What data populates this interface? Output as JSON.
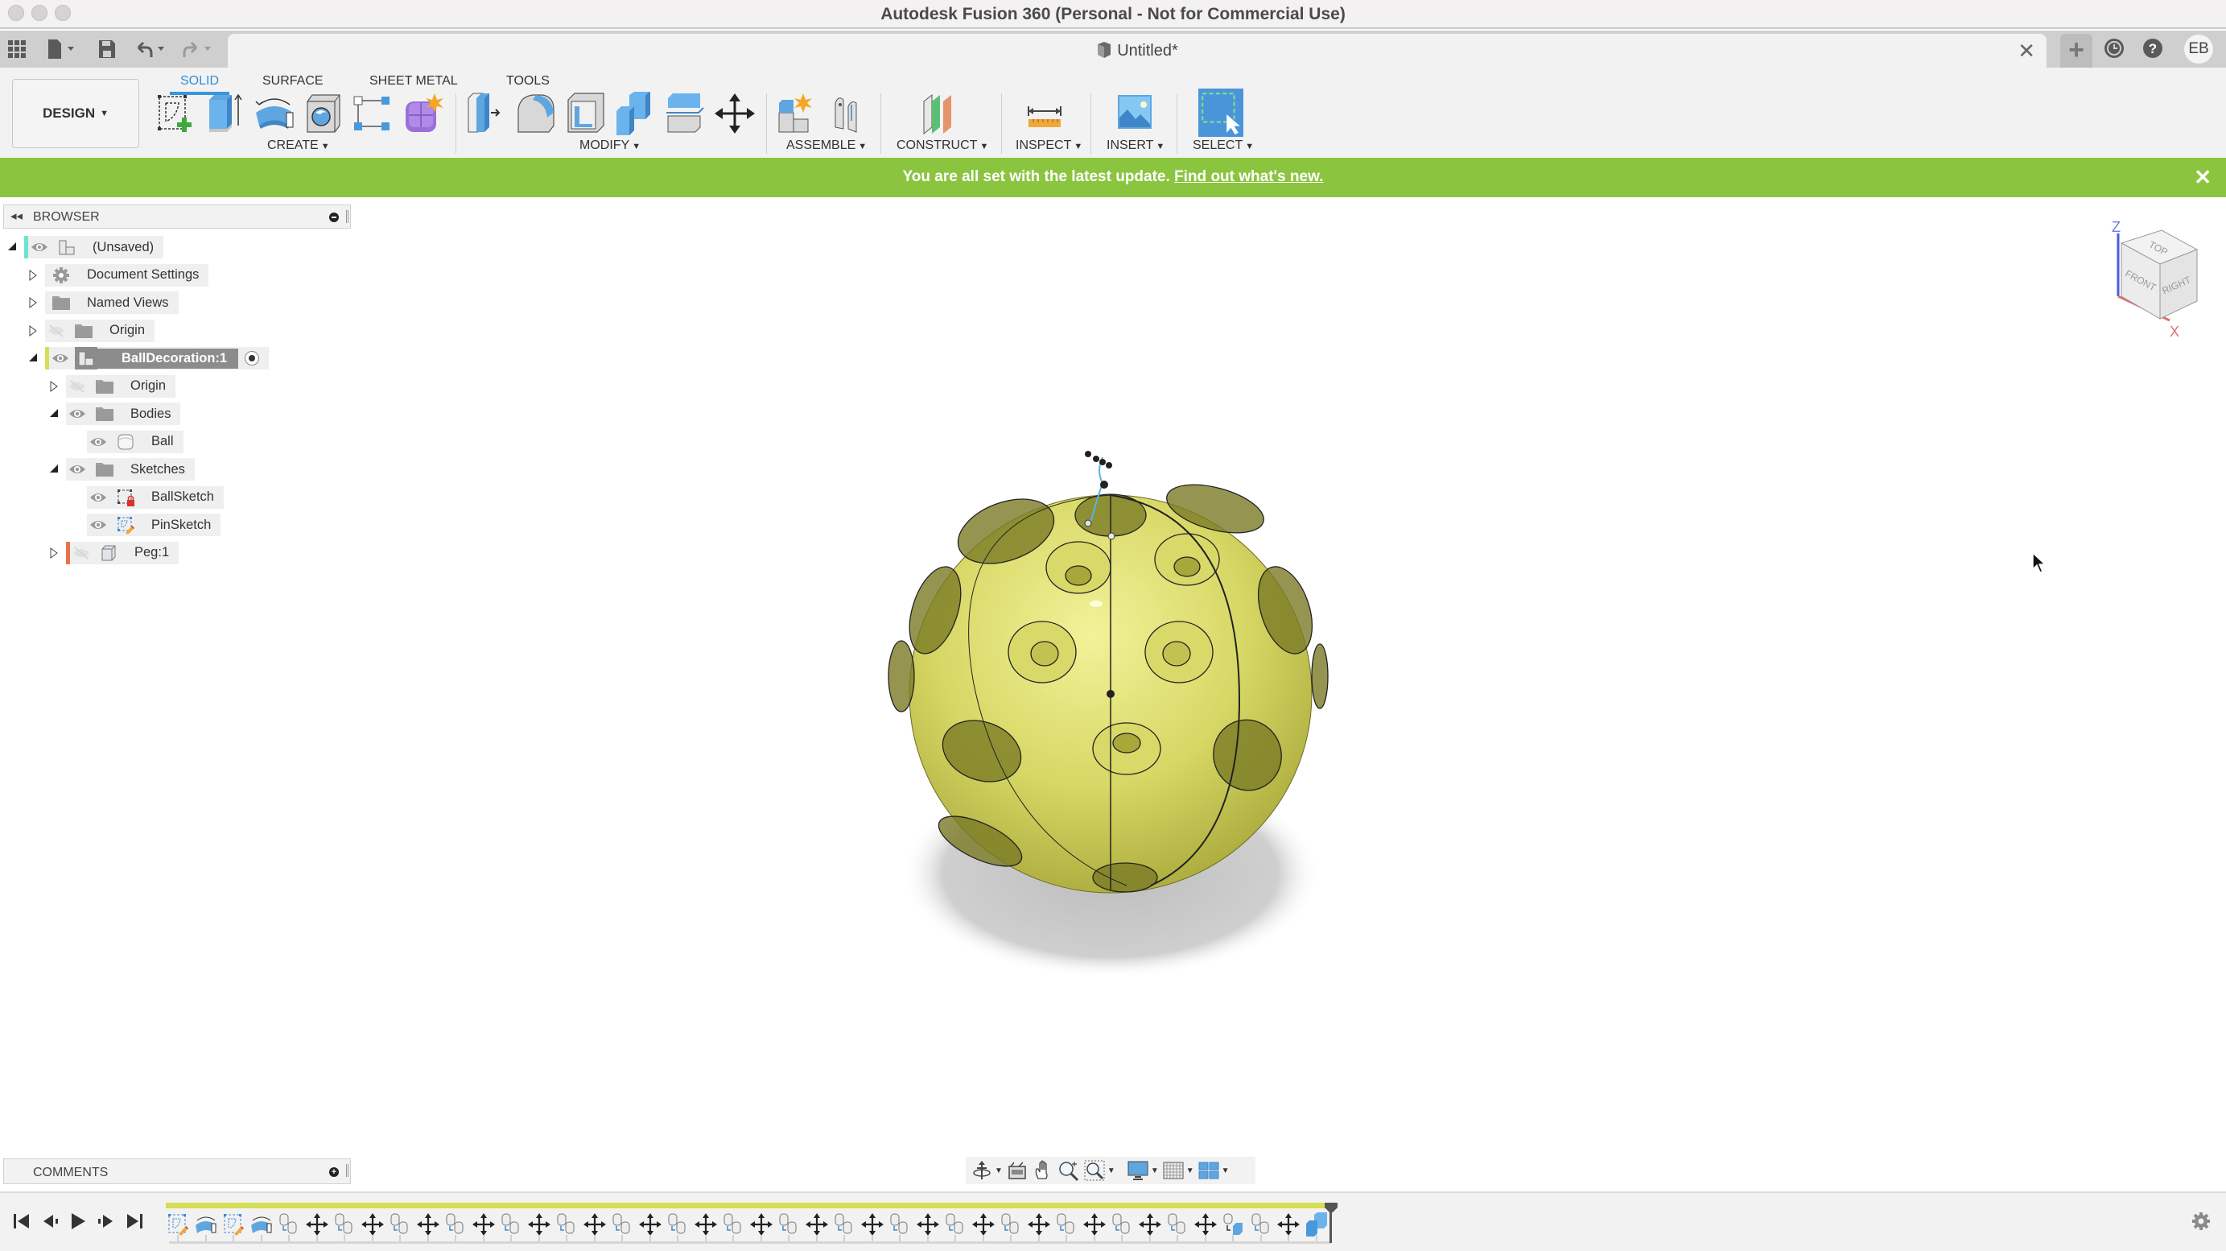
{
  "window": {
    "title": "Autodesk Fusion 360 (Personal - Not for Commercial Use)"
  },
  "tabbar": {
    "document_tab_title": "Untitled*",
    "user_initials": "EB",
    "icons": [
      "apps-grid-icon",
      "file-icon",
      "save-icon",
      "undo-icon",
      "redo-icon",
      "close-icon",
      "new-tab-plus-icon",
      "job-status-clock-icon",
      "help-icon"
    ]
  },
  "toolbar": {
    "workspace_button": "DESIGN",
    "tabs": [
      {
        "label": "SOLID",
        "active": true
      },
      {
        "label": "SURFACE",
        "active": false
      },
      {
        "label": "SHEET METAL",
        "active": false
      },
      {
        "label": "TOOLS",
        "active": false
      }
    ],
    "groups": [
      {
        "label": "CREATE",
        "tools": [
          "create-sketch",
          "extrude",
          "revolve",
          "hole",
          "pattern",
          "create-form"
        ]
      },
      {
        "label": "MODIFY",
        "tools": [
          "press-pull",
          "fillet",
          "shell",
          "combine",
          "split-body",
          "move-copy"
        ]
      },
      {
        "label": "ASSEMBLE",
        "tools": [
          "new-component",
          "joint"
        ]
      },
      {
        "label": "CONSTRUCT",
        "tools": [
          "offset-plane"
        ]
      },
      {
        "label": "INSPECT",
        "tools": [
          "measure"
        ]
      },
      {
        "label": "INSERT",
        "tools": [
          "insert-image"
        ]
      },
      {
        "label": "SELECT",
        "tools": [
          "select"
        ]
      }
    ]
  },
  "banner": {
    "message": "You are all set with the latest update.",
    "link_text": "Find out what's new.",
    "color": "#8bc540"
  },
  "browser": {
    "title": "BROWSER",
    "items": [
      {
        "label": "(Unsaved)",
        "level": 0,
        "expanded": true,
        "visible": true,
        "icon": "component",
        "color": "#6fe3cf"
      },
      {
        "label": "Document Settings",
        "level": 1,
        "expanded": false,
        "icon": "gear"
      },
      {
        "label": "Named Views",
        "level": 1,
        "expanded": false,
        "icon": "folder"
      },
      {
        "label": "Origin",
        "level": 1,
        "expanded": false,
        "visible": false,
        "icon": "folder"
      },
      {
        "label": "BallDecoration:1",
        "level": 1,
        "expanded": true,
        "visible": true,
        "icon": "component",
        "active": true,
        "color": "#d6de55"
      },
      {
        "label": "Origin",
        "level": 2,
        "expanded": false,
        "visible": false,
        "icon": "folder"
      },
      {
        "label": "Bodies",
        "level": 2,
        "expanded": true,
        "visible": true,
        "icon": "folder"
      },
      {
        "label": "Ball",
        "level": 3,
        "visible": true,
        "icon": "body"
      },
      {
        "label": "Sketches",
        "level": 2,
        "expanded": true,
        "visible": true,
        "icon": "folder"
      },
      {
        "label": "BallSketch",
        "level": 3,
        "visible": true,
        "icon": "sketch-locked"
      },
      {
        "label": "PinSketch",
        "level": 3,
        "visible": true,
        "icon": "sketch-edit"
      },
      {
        "label": "Peg:1",
        "level": 2,
        "expanded": false,
        "visible": false,
        "icon": "component-box",
        "color": "#e8734a"
      }
    ]
  },
  "viewcube": {
    "faces": [
      "TOP",
      "FRONT",
      "RIGHT"
    ],
    "axes": [
      "Z",
      "X"
    ]
  },
  "model": {
    "body_color": "#dcdc6a"
  },
  "comments": {
    "title": "COMMENTS"
  },
  "navbar": {
    "tools": [
      "orbit-icon",
      "look-at-icon",
      "pan-icon",
      "zoom-icon",
      "fit-icon",
      "display-settings-icon",
      "grid-icon",
      "viewports-icon"
    ]
  },
  "timeline": {
    "controls": [
      "go-to-start",
      "step-back",
      "play",
      "step-forward",
      "go-to-end"
    ],
    "features": [
      "sketch",
      "revolve",
      "sketch",
      "revolve",
      "copy-body",
      "move",
      "copy-body",
      "move",
      "copy-body",
      "move",
      "copy-body",
      "move",
      "copy-body",
      "move",
      "copy-body",
      "move",
      "copy-body",
      "move",
      "copy-body",
      "move",
      "copy-body",
      "move",
      "copy-body",
      "move",
      "copy-body",
      "move",
      "copy-body",
      "move",
      "copy-body",
      "move",
      "copy-body",
      "move",
      "copy-body",
      "move",
      "copy-body",
      "move",
      "copy-body",
      "move",
      "body-to-component",
      "copy-body",
      "move",
      "combine"
    ]
  }
}
